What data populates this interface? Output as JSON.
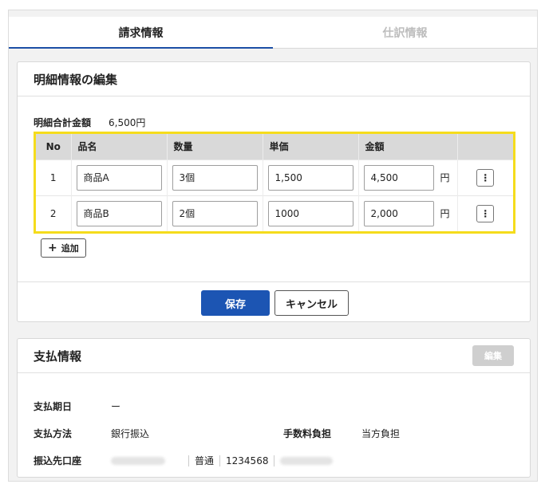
{
  "tabs": [
    {
      "label": "請求情報",
      "active": true
    },
    {
      "label": "仕訳情報",
      "active": false
    }
  ],
  "detail_card": {
    "title": "明細情報の編集",
    "total_label": "明細合計金額",
    "total_value": "6,500円",
    "columns": [
      "No",
      "品名",
      "数量",
      "単価",
      "金額",
      ""
    ],
    "rows": [
      {
        "no": "1",
        "name": "商品A",
        "qty": "3個",
        "price": "1,500",
        "amount": "4,500",
        "unit": "円"
      },
      {
        "no": "2",
        "name": "商品B",
        "qty": "2個",
        "price": "1000",
        "amount": "2,000",
        "unit": "円"
      }
    ],
    "add_label": "追加",
    "save_label": "保存",
    "cancel_label": "キャンセル"
  },
  "payment_card": {
    "title": "支払情報",
    "edit_label": "編集",
    "due_label": "支払期日",
    "due_value": "ー",
    "method_label": "支払方法",
    "method_value": "銀行振込",
    "fee_label": "手数料負担",
    "fee_value": "当方負担",
    "account_label": "振込先口座",
    "account_type": "普通",
    "account_number": "1234568"
  },
  "colors": {
    "accent": "#1c55b3",
    "highlight": "#f5dc1c"
  }
}
